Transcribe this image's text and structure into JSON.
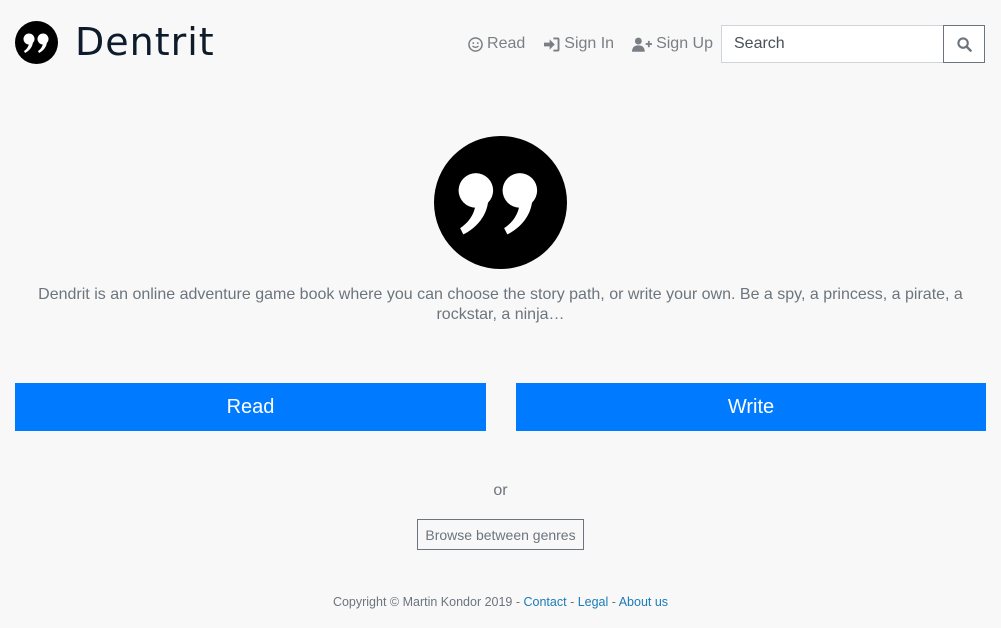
{
  "brand": {
    "name": "Dentrit",
    "logo_icon": "quote-icon"
  },
  "nav": {
    "read_label": "Read",
    "read_icon": "smile-icon",
    "signin_label": "Sign In",
    "signin_icon": "sign-in-icon",
    "signup_label": "Sign Up",
    "signup_icon": "user-plus-icon",
    "search_placeholder": "Search",
    "search_icon": "search-icon"
  },
  "hero": {
    "icon": "quote-icon",
    "tagline": "Dendrit is an online adventure game book where you can choose the story path, or write your own. Be a spy, a princess, a pirate, a rockstar, a ninja…"
  },
  "actions": {
    "read_label": "Read",
    "write_label": "Write",
    "or_text": "or",
    "browse_label": "Browse between genres"
  },
  "footer": {
    "copyright": "Copyright © Martin Kondor 2019",
    "separator": " - ",
    "links": [
      "Contact",
      "Legal",
      "About us"
    ]
  },
  "colors": {
    "primary": "#007bff",
    "background": "#f8f8f8",
    "muted_text": "#6c757d",
    "link": "#1a7bb9"
  }
}
